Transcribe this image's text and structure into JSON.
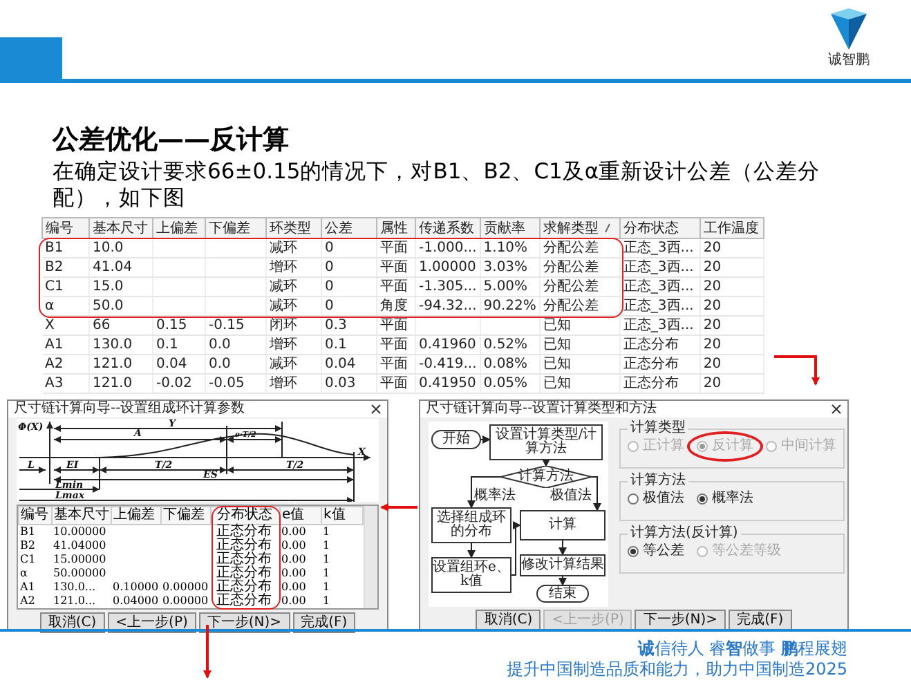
{
  "header": {
    "logo_text": "诚智鹏"
  },
  "title": "公差优化——反计算",
  "intro": "在确定设计要求66±0.15的情况下，对B1、B2、C1及α重新设计公差（公差分配），如下图",
  "table": {
    "columns": [
      {
        "label": "编号",
        "sorted": false
      },
      {
        "label": "基本尺寸",
        "sorted": false
      },
      {
        "label": "上偏差",
        "sorted": false
      },
      {
        "label": "下偏差",
        "sorted": false
      },
      {
        "label": "环类型",
        "sorted": false
      },
      {
        "label": "公差",
        "sorted": false
      },
      {
        "label": "属性",
        "sorted": false
      },
      {
        "label": "传递系数",
        "sorted": false
      },
      {
        "label": "贡献率",
        "sorted": false
      },
      {
        "label": "求解类型",
        "sorted": true
      },
      {
        "label": "分布状态",
        "sorted": false
      },
      {
        "label": "工作温度",
        "sorted": false
      }
    ],
    "rows": [
      {
        "circled": true,
        "cells": [
          "B1",
          "10.0",
          null,
          null,
          "减环",
          "0",
          "平面",
          "-1.000...",
          "1.10%",
          "分配公差",
          "正态_3西...",
          "20"
        ]
      },
      {
        "circled": true,
        "cells": [
          "B2",
          "41.04",
          null,
          null,
          "增环",
          "0",
          "平面",
          "1.00000",
          "3.03%",
          "分配公差",
          "正态_3西...",
          "20"
        ]
      },
      {
        "circled": true,
        "cells": [
          "C1",
          "15.0",
          null,
          null,
          "减环",
          "0",
          "平面",
          "-1.305...",
          "5.00%",
          "分配公差",
          "正态_3西...",
          "20"
        ]
      },
      {
        "circled": true,
        "cells": [
          "α",
          "50.0",
          null,
          null,
          "减环",
          "0",
          "角度",
          "-94.32...",
          "90.22%",
          "分配公差",
          "正态_3西...",
          "20"
        ]
      },
      {
        "circled": false,
        "cells": [
          "X",
          "66",
          "0.15",
          "-0.15",
          "闭环",
          "0.3",
          "平面",
          null,
          null,
          "已知",
          "正态_3西...",
          "20"
        ]
      },
      {
        "circled": false,
        "cells": [
          "A1",
          "130.0",
          "0.1",
          "0.0",
          "增环",
          "0.1",
          "平面",
          "0.41960",
          "0.52%",
          "已知",
          "正态分布",
          "20"
        ]
      },
      {
        "circled": false,
        "cells": [
          "A2",
          "121.0",
          "0.04",
          "0.0",
          "减环",
          "0.04",
          "平面",
          "-0.419...",
          "0.08%",
          "已知",
          "正态分布",
          "20"
        ]
      },
      {
        "circled": false,
        "cells": [
          "A3",
          "121.0",
          "-0.02",
          "-0.05",
          "增环",
          "0.03",
          "平面",
          "0.41950",
          "0.05%",
          "已知",
          "正态分布",
          "20"
        ]
      }
    ]
  },
  "parameter_dialog": {
    "title": "尺寸链计算向导--设置组成环计算参数",
    "diagram_labels": [
      "Φ(X)",
      "Y",
      "A",
      "e·T/2",
      "X",
      "L",
      "EI",
      "T/2",
      "T/2",
      "ES",
      "Lmin",
      "Lmax"
    ],
    "columns": [
      {
        "label": "编号",
        "circled": false
      },
      {
        "label": "基本尺寸",
        "circled": false
      },
      {
        "label": "上偏差",
        "circled": false
      },
      {
        "label": "下偏差",
        "circled": false
      },
      {
        "label": "分布状态",
        "circled": true
      },
      {
        "label": "e值",
        "circled": false
      },
      {
        "label": "k值",
        "circled": false
      }
    ],
    "rows": [
      [
        "B1",
        "10.00000",
        null,
        null,
        "正态分布",
        "0.00",
        "1"
      ],
      [
        "B2",
        "41.04000",
        null,
        null,
        "正态分布",
        "0.00",
        "1"
      ],
      [
        "C1",
        "15.00000",
        null,
        null,
        "正态分布",
        "0.00",
        "1"
      ],
      [
        "α",
        "50.00000",
        null,
        null,
        "正态分布",
        "0.00",
        "1"
      ],
      [
        "A1",
        "130.0...",
        "0.10000",
        "0.00000",
        "正态分布",
        "0.00",
        "1"
      ],
      [
        "A2",
        "121.0...",
        "0.04000",
        "0.00000",
        "正态分布",
        "0.00",
        "1"
      ]
    ],
    "buttons": [
      {
        "label": "取消(C)",
        "disabled": false
      },
      {
        "label": "<上一步(P)",
        "disabled": false
      },
      {
        "label": "下一步(N)>",
        "disabled": false
      },
      {
        "label": "完成(F)",
        "disabled": false
      }
    ]
  },
  "method_dialog": {
    "title": "尺寸链计算向导--设置计算类型和方法",
    "flowchart": {
      "nodes": [
        {
          "kind": "terminal",
          "text": "开始"
        },
        {
          "kind": "process",
          "text": "设置计算类型/计算方法"
        },
        {
          "kind": "decision",
          "text": "计算方法"
        },
        {
          "kind": "process",
          "text": "选择组成环的分布"
        },
        {
          "kind": "process",
          "text": "计算"
        },
        {
          "kind": "process",
          "text": "设置组环e、k值"
        },
        {
          "kind": "process",
          "text": "修改计算结果"
        },
        {
          "kind": "terminal",
          "text": "结束"
        }
      ],
      "branch_labels": [
        "概率法",
        "极值法"
      ]
    },
    "groups": [
      {
        "legend": "计算类型",
        "options": [
          {
            "label": "正计算",
            "selected": false,
            "disabled": true,
            "circled": false
          },
          {
            "label": "反计算",
            "selected": true,
            "disabled": true,
            "circled": true
          },
          {
            "label": "中间计算",
            "selected": false,
            "disabled": true,
            "circled": false
          }
        ]
      },
      {
        "legend": "计算方法",
        "options": [
          {
            "label": "极值法",
            "selected": false,
            "disabled": false,
            "circled": false
          },
          {
            "label": "概率法",
            "selected": true,
            "disabled": false,
            "circled": false
          }
        ]
      },
      {
        "legend": "计算方法(反计算)",
        "options": [
          {
            "label": "等公差",
            "selected": true,
            "disabled": false,
            "circled": false
          },
          {
            "label": "等公差等级",
            "selected": false,
            "disabled": true,
            "circled": false
          }
        ]
      }
    ],
    "buttons": [
      {
        "label": "取消(C)",
        "disabled": false
      },
      {
        "label": "<上一步(P)",
        "disabled": true
      },
      {
        "label": "下一步(N)>",
        "disabled": false
      },
      {
        "label": "完成(F)",
        "disabled": false
      }
    ]
  },
  "footer": {
    "slogan": "**诚**信待人 睿**智**做事 **鹏**程展翅",
    "tagline": "提升中国制造品质和能力，助力中国制造2025"
  }
}
